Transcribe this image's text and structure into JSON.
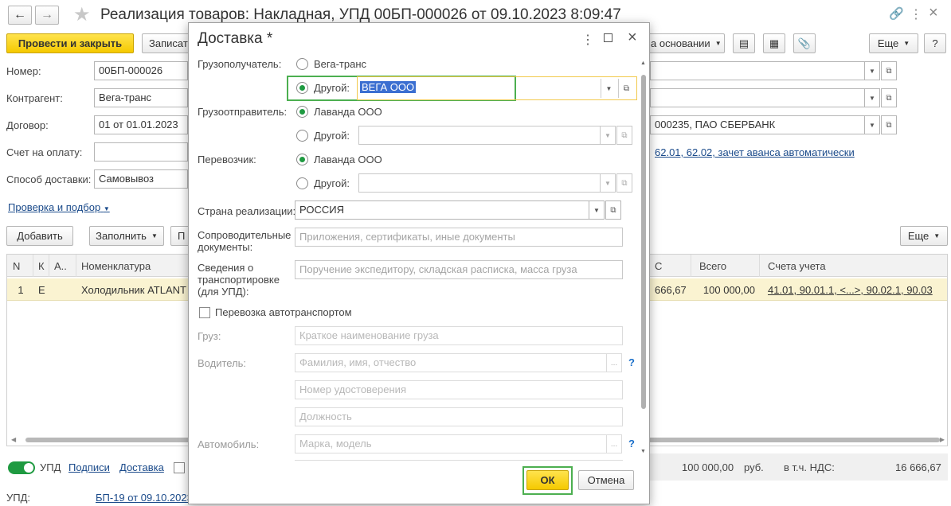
{
  "window": {
    "title": "Реализация товаров: Накладная, УПД 00БП-000026 от 09.10.2023 8:09:47"
  },
  "toolbar": {
    "post_close": "Провести и закрыть",
    "write": "Записать",
    "based_on": "а основании",
    "more": "Еще"
  },
  "form": {
    "number_label": "Номер:",
    "number_value": "00БП-000026",
    "contractor_label": "Контрагент:",
    "contractor_value": "Вега-транс",
    "contract_label": "Договор:",
    "contract_value": "01 от 01.01.2023",
    "bank_value": "000235, ПАО СБЕРБАНК",
    "invoice_label": "Счет на оплату:",
    "delivery_label": "Способ доставки:",
    "delivery_value": "Самовывоз",
    "accounts_link": "62.01, 62.02, зачет аванса автоматически",
    "check_link": "Проверка и подбор"
  },
  "table_toolbar": {
    "add": "Добавить",
    "fill": "Заполнить",
    "more": "Еще"
  },
  "table": {
    "headers": [
      "N",
      "К",
      "А..",
      "Номенклатура",
      "С",
      "Всего",
      "Счета учета"
    ],
    "row": {
      "n": "1",
      "k": "Е",
      "nomenclature": "Холодильник ATLANT",
      "vat": "666,67",
      "total": "100 000,00",
      "accounts": "41.01, 90.01.1, <...>, 90.02.1, 90.03"
    }
  },
  "footer": {
    "upd_toggle": "УПД",
    "signatures": "Подписи",
    "delivery": "Доставка",
    "total": "100 000,00",
    "currency": "руб.",
    "vat_label": "в т.ч. НДС:",
    "vat_value": "16 666,67",
    "upd_label": "УПД:",
    "upd_link": "БП-19 от 09.10.2023"
  },
  "dialog": {
    "title": "Доставка *",
    "consignee_label": "Грузополучатель:",
    "consignee_opt1": "Вега-транс",
    "consignee_opt2": "Другой:",
    "consignee_value": "ВЕГА ООО",
    "shipper_label": "Грузоотправитель:",
    "shipper_opt1": "Лаванда ООО",
    "shipper_opt2": "Другой:",
    "carrier_label": "Перевозчик:",
    "carrier_opt1": "Лаванда ООО",
    "carrier_opt2": "Другой:",
    "country_label": "Страна реализации:",
    "country_value": "РОССИЯ",
    "docs_label": "Сопроводительные документы:",
    "docs_placeholder": "Приложения, сертификаты, иные документы",
    "transport_label": "Сведения о транспортировке (для УПД):",
    "transport_placeholder": "Поручение экспедитору, складская расписка, масса груза",
    "auto_checkbox": "Перевозка автотранспортом",
    "cargo_label": "Груз:",
    "cargo_placeholder": "Краткое наименование груза",
    "driver_label": "Водитель:",
    "driver_placeholder": "Фамилия, имя, отчество",
    "license_placeholder": "Номер удостоверения",
    "position_placeholder": "Должность",
    "car_label": "Автомобиль:",
    "car_placeholder": "Марка, модель",
    "ok": "ОК",
    "cancel": "Отмена"
  }
}
